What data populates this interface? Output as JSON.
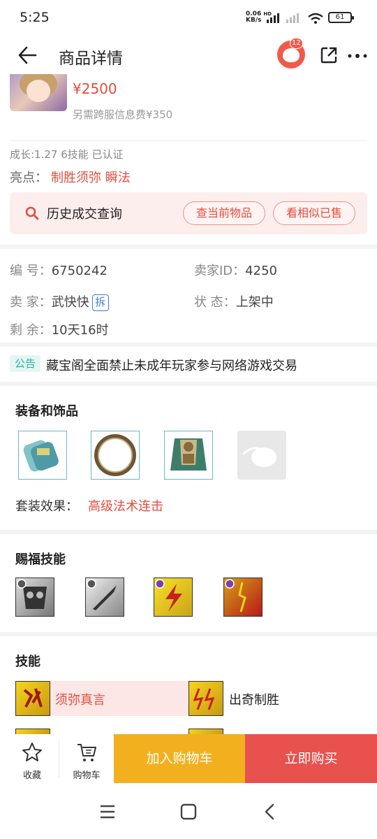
{
  "status_bar": {
    "time": "5:25",
    "net_speed_top": "0.06",
    "net_speed_bottom": "KB/s",
    "hd": "HD",
    "battery": "61"
  },
  "nav": {
    "title": "商品详情",
    "badge_count": "12"
  },
  "product": {
    "price": "¥2500",
    "cross_server_fee": "另需跨服信息费¥350",
    "growth_info": "成长:1.27 6技能 已认证",
    "highlight_label": "亮点：",
    "highlight_value": "制胜须弥 瞬法"
  },
  "history": {
    "label": "历史成交查询",
    "btn_current": "查当前物品",
    "btn_similar": "看相似已售"
  },
  "info": {
    "id_label": "编  号：",
    "id_value": "6750242",
    "seller_id_label": "卖家ID：",
    "seller_id_value": "4250",
    "seller_label": "卖  家：",
    "seller_value": "武快快",
    "seller_tag": "拆",
    "status_label": "状  态：",
    "status_value": "上架中",
    "remain_label": "剩  余：",
    "remain_value": "10天16时"
  },
  "notice": {
    "tag": "公告",
    "text": "藏宝阁全面禁止未成年玩家参与网络游戏交易"
  },
  "equipment": {
    "title": "装备和饰品",
    "items": [
      "bracer-icon",
      "ring-icon",
      "armor-icon",
      "empty-slot-icon"
    ],
    "set_label": "套装效果：",
    "set_value": "高级法术连击"
  },
  "blessing": {
    "title": "赐福技能",
    "items": [
      "mask-skill-icon",
      "sword-skill-icon",
      "lightning-skill-icon",
      "crack-skill-icon"
    ]
  },
  "skills": {
    "title": "技能",
    "items": [
      {
        "name": "须弥真言",
        "highlight": true
      },
      {
        "name": "出奇制胜",
        "highlight": false
      }
    ]
  },
  "bottom_bar": {
    "favorite": "收藏",
    "cart": "购物车",
    "add_cart": "加入购物车",
    "buy_now": "立即购买"
  },
  "colors": {
    "accent_red": "#e34d3d",
    "cart_yellow": "#f2b01e",
    "buy_red": "#e8514d",
    "notice_teal": "#2bb0a0"
  }
}
